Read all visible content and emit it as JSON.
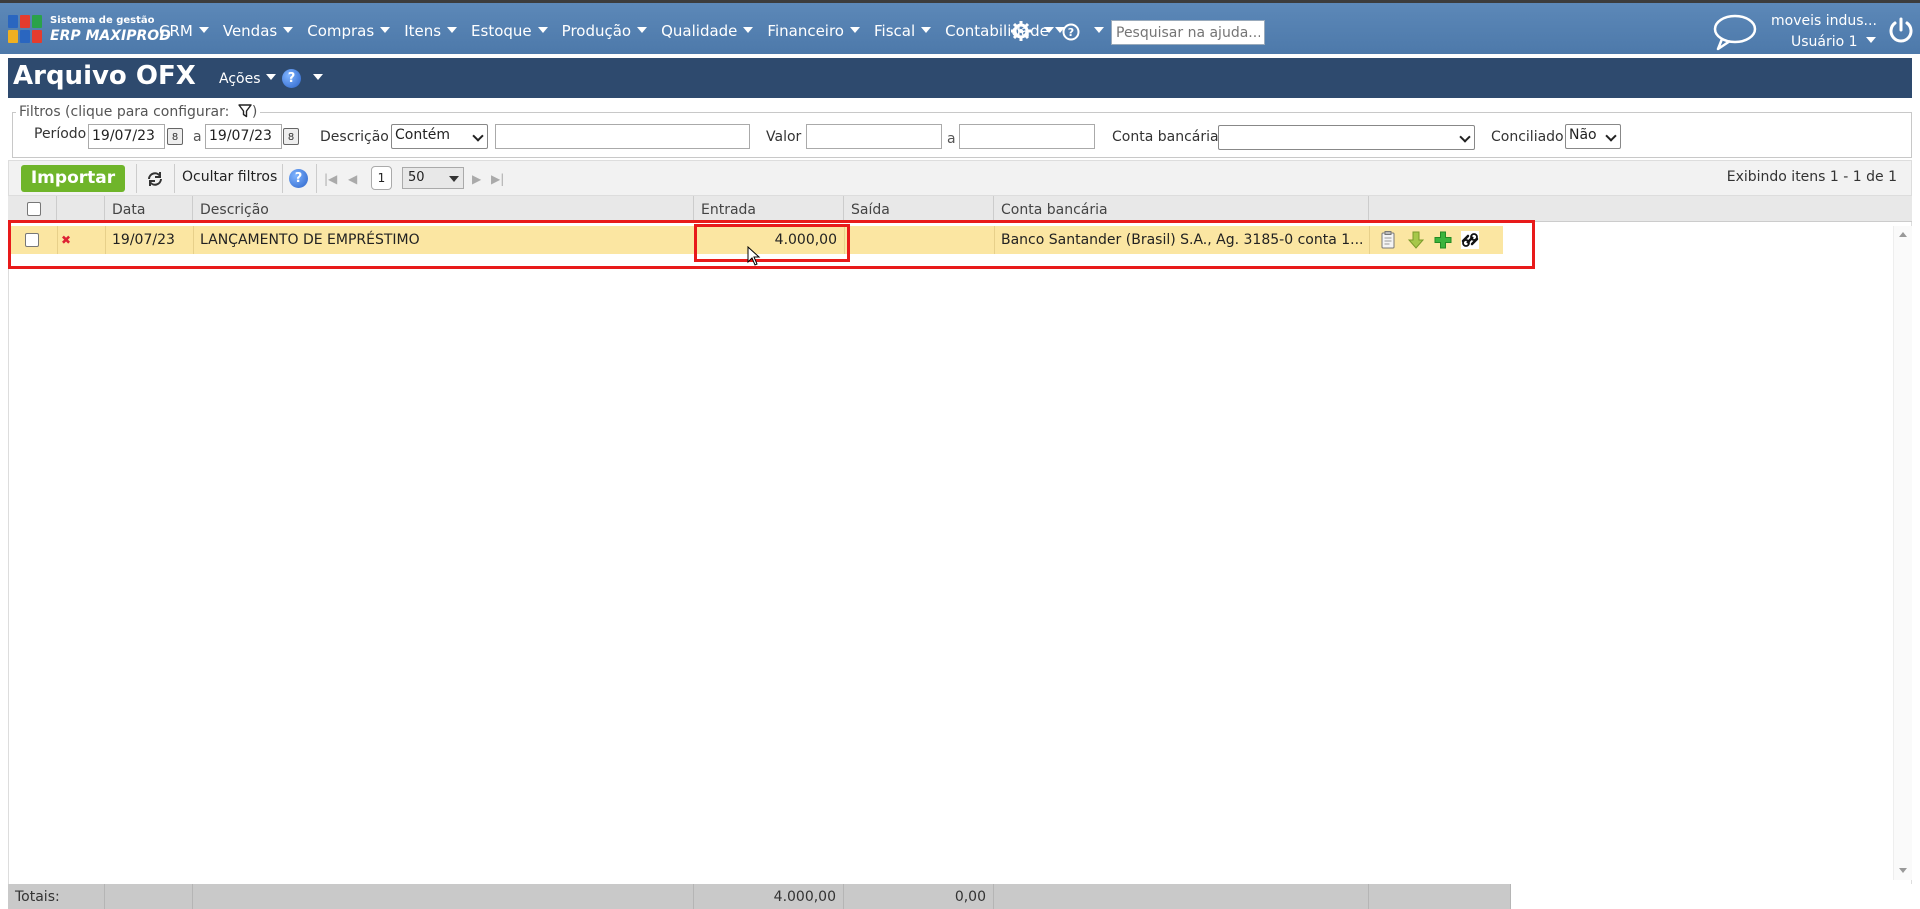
{
  "nav": {
    "logo_line1": "Sistema de gestão",
    "logo_line2": "ERP MAXIPROD",
    "menu": [
      "CRM",
      "Vendas",
      "Compras",
      "Itens",
      "Estoque",
      "Produção",
      "Qualidade",
      "Financeiro",
      "Fiscal",
      "Contabilidade"
    ],
    "settings_icon": "gear-icon",
    "help_icon": "help-icon",
    "help_search_placeholder": "Pesquisar na ajuda...",
    "user_company": "moveis indus...",
    "user_name": "Usuário 1"
  },
  "page": {
    "title": "Arquivo OFX",
    "actions_label": "Ações",
    "help_label": "?"
  },
  "filters": {
    "legend": "Filtros (clique para configurar:",
    "legend_end": ")",
    "periodo_label": "Período",
    "date_from": "19/07/23",
    "date_sep": "a",
    "date_to": "19/07/23",
    "descricao_label": "Descrição",
    "descricao_mode": "Contém",
    "descricao_value": "",
    "valor_label": "Valor",
    "valor_from": "",
    "valor_sep": "a",
    "valor_to": "",
    "conta_label": "Conta bancária",
    "conta_value": "",
    "conciliado_label": "Conciliado",
    "conciliado_value": "Não"
  },
  "toolbar": {
    "import_label": "Importar",
    "hide_filters_label": "Ocultar filtros",
    "help_label": "?",
    "page_number": "1",
    "page_size": "50",
    "count_text": "Exibindo itens 1 - 1 de 1"
  },
  "grid": {
    "columns": [
      "Data",
      "Descrição",
      "Entrada",
      "Saída",
      "Conta bancária"
    ],
    "rows": [
      {
        "date": "19/07/23",
        "description": "LANÇAMENTO DE EMPRÉSTIMO",
        "entrada": "4.000,00",
        "saida": "",
        "conta": "Banco Santander (Brasil) S.A., Ag. 3185-0 conta 1..."
      }
    ],
    "row_actions": [
      "clipboard-icon",
      "download-arrow-icon",
      "add-icon",
      "link-icon"
    ]
  },
  "totals": {
    "label": "Totais:",
    "entrada": "4.000,00",
    "saida": "0,00"
  },
  "colors": {
    "nav_bg": "#5381b3",
    "header_bg": "#2e4a6e",
    "import_green": "#6fb52a",
    "row_highlight": "#fbe6a2",
    "annotation_red": "#e81a1a"
  }
}
